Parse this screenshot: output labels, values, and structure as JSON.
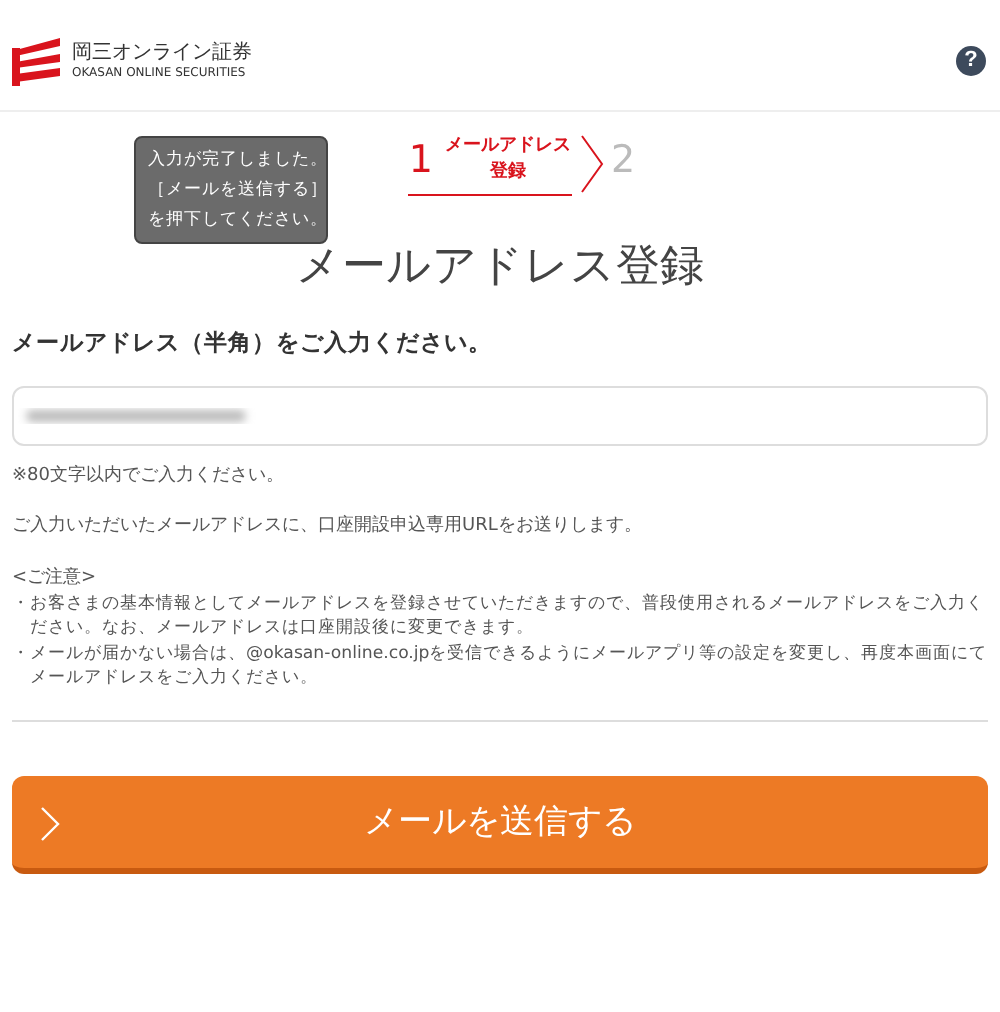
{
  "header": {
    "logo_ja": "岡三オンライン証券",
    "logo_en": "OKASAN ONLINE SECURITIES",
    "help": "?"
  },
  "steps": [
    {
      "number": "1",
      "label": [
        "メールアドレス",
        "登録"
      ],
      "selected": true
    },
    {
      "number": "2",
      "selected": false
    }
  ],
  "tooltip": {
    "lines": [
      "入力が完了しました。",
      "［メールを送信する］",
      "を押下してください。"
    ]
  },
  "title": "メールアドレス登録",
  "form": {
    "label": "メールアドレス（半角）をご入力ください。",
    "note": "※80文字以内でご入力ください。",
    "info": "ご入力いただいたメールアドレスに、口座開設申込専用URLをお送りします。"
  },
  "notice": {
    "heading": "<ご注意>",
    "items": [
      "・お客さまの基本情報としてメールアドレスを登録させていただきますので、普段使用されるメールアドレスをご入力ください。なお、メールアドレスは口座開設後に変更できます。",
      "・メールが届かない場合は、@okasan-online.co.jpを受信できるようにメールアプリ等の設定を変更し、再度本画面にてメールアドレスをご入力ください。"
    ]
  },
  "submit": "メールを送信する"
}
